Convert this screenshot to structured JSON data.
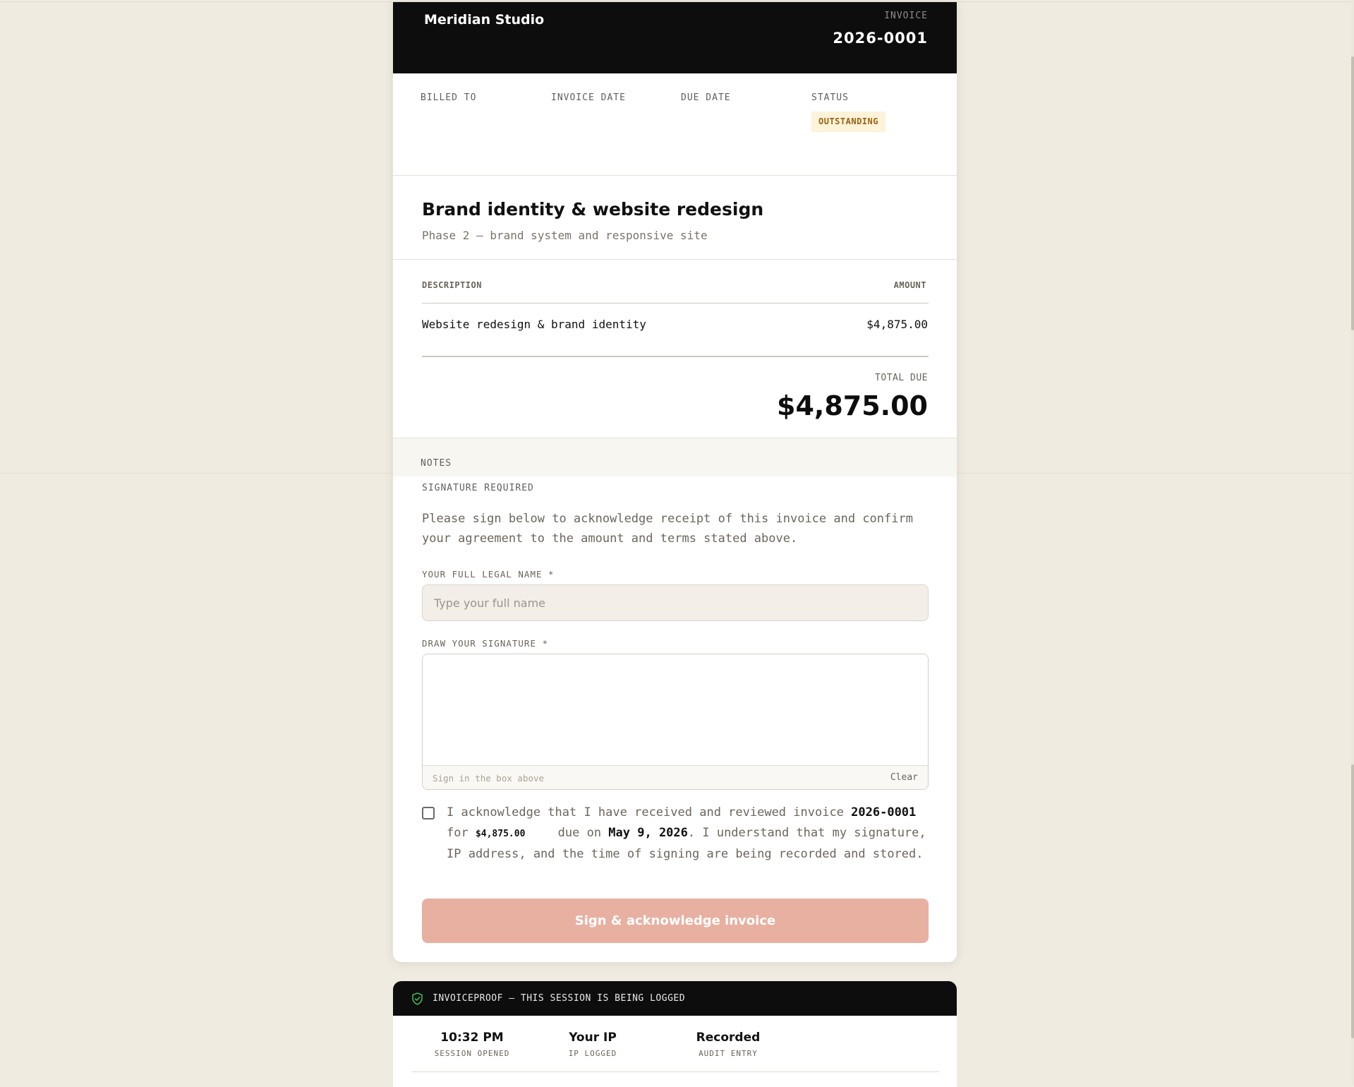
{
  "header": {
    "studio_name": "Meridian Studio",
    "invoice_label": "INVOICE",
    "invoice_number": "2026-0001"
  },
  "meta": {
    "billed_to_label": "BILLED TO",
    "invoice_date_label": "INVOICE DATE",
    "due_date_label": "DUE DATE",
    "status_label": "STATUS",
    "status_value": "OUTSTANDING"
  },
  "project": {
    "title": "Brand identity & website redesign",
    "subtitle": "Phase 2 — brand system and responsive site"
  },
  "line_items": {
    "description_header": "DESCRIPTION",
    "amount_header": "AMOUNT",
    "items": [
      {
        "description": "Website redesign & brand identity",
        "amount": "$4,875.00"
      }
    ],
    "total_label": "TOTAL DUE",
    "total_value": "$4,875.00"
  },
  "notes": {
    "label": "NOTES"
  },
  "signature": {
    "required_label": "SIGNATURE REQUIRED",
    "instructions": "Please sign below to acknowledge receipt of this invoice and confirm your agreement to the amount and terms stated above.",
    "name_label": "YOUR FULL LEGAL NAME *",
    "name_placeholder": "Type your full name",
    "draw_label": "DRAW YOUR SIGNATURE *",
    "draw_hint": "Sign in the box above",
    "clear_label": "Clear"
  },
  "acknowledgement": {
    "text_1": "I acknowledge that I have received and reviewed invoice ",
    "invoice_number": "2026-0001",
    "text_2": " for ",
    "amount": "$4,875.00",
    "text_3": " due on ",
    "due_date": "May 9, 2026",
    "text_4": ". I understand that my signature, IP address, and the time of signing are being recorded and stored.",
    "checked": false
  },
  "submit": {
    "label": "Sign & acknowledge invoice"
  },
  "audit": {
    "title": "INVOICEPROOF — THIS SESSION IS BEING LOGGED",
    "stats": [
      {
        "value": "10:32 PM",
        "caption": "SESSION OPENED"
      },
      {
        "value": "Your IP",
        "caption": "IP LOGGED"
      },
      {
        "value": "Recorded",
        "caption": "AUDIT ENTRY"
      }
    ]
  },
  "colors": {
    "page_background": "#efebe1",
    "header_background": "#0d0d0d",
    "status_badge_bg": "#fdf3d9",
    "status_badge_text": "#9a6212",
    "submit_button": "#e8b0a1",
    "shield_icon": "#3fb950"
  },
  "icons": {
    "audit": "shield-check-icon"
  }
}
